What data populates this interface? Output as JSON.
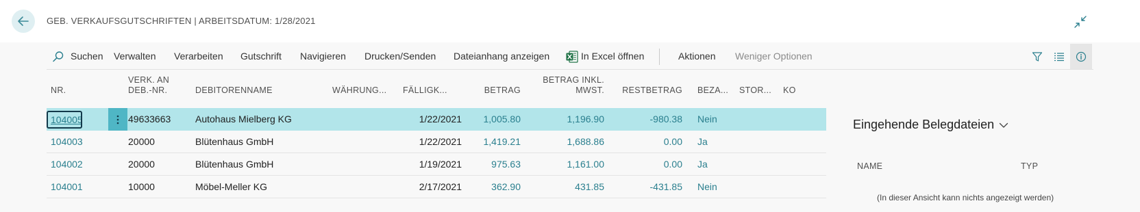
{
  "header": {
    "title": "GEB. VERKAUFSGUTSCHRIFTEN | ARBEITSDATUM: 1/28/2021"
  },
  "actionbar": {
    "search": "Suchen",
    "manage": "Verwalten",
    "process": "Verarbeiten",
    "credit_memo": "Gutschrift",
    "navigate": "Navigieren",
    "print_send": "Drucken/Senden",
    "attachment": "Dateianhang anzeigen",
    "excel": "In Excel öffnen",
    "actions": "Aktionen",
    "fewer_options": "Weniger Optionen"
  },
  "table": {
    "columns": {
      "nr": "NR.",
      "sell_to_line1": "VERK. AN",
      "sell_to_line2": "DEB.-NR.",
      "customer_name": "DEBITORENNAME",
      "currency": "WÄHRUNG...",
      "due_date": "FÄLLIGK...",
      "amount": "BETRAG",
      "amount_incl_line1": "BETRAG INKL.",
      "amount_incl_line2": "MWST.",
      "remaining": "RESTBETRAG",
      "paid": "BEZA...",
      "cancelled": "STOR...",
      "extra": "KO"
    },
    "rows": [
      {
        "nr": "104005",
        "customer_no": "49633663",
        "name": "Autohaus Mielberg KG",
        "due": "1/22/2021",
        "amount": "1,005.80",
        "amount_incl": "1,196.90",
        "remaining": "-980.38",
        "paid": "Nein"
      },
      {
        "nr": "104003",
        "customer_no": "20000",
        "name": "Blütenhaus GmbH",
        "due": "1/22/2021",
        "amount": "1,419.21",
        "amount_incl": "1,688.86",
        "remaining": "0.00",
        "paid": "Ja"
      },
      {
        "nr": "104002",
        "customer_no": "20000",
        "name": "Blütenhaus GmbH",
        "due": "1/19/2021",
        "amount": "975.63",
        "amount_incl": "1,161.00",
        "remaining": "0.00",
        "paid": "Ja"
      },
      {
        "nr": "104001",
        "customer_no": "10000",
        "name": "Möbel-Meller KG",
        "due": "2/17/2021",
        "amount": "362.90",
        "amount_incl": "431.85",
        "remaining": "-431.85",
        "paid": "Nein"
      }
    ]
  },
  "factbox": {
    "title": "Eingehende Belegdateien",
    "col_name": "NAME",
    "col_type": "TYP",
    "empty_text": "(In dieser Ansicht kann nichts angezeigt werden)"
  },
  "colors": {
    "accent": "#2a7f8e",
    "selected_row": "#b2e5ea",
    "excel_green": "#1e7145"
  },
  "icons": [
    "back-arrow-icon",
    "collapse-icon",
    "search-icon",
    "excel-icon",
    "filter-icon",
    "list-view-icon",
    "info-icon",
    "more-vertical-icon",
    "chevron-down-icon"
  ]
}
